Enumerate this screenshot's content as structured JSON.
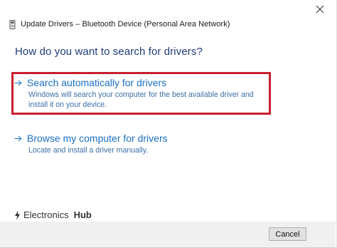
{
  "window": {
    "title": "Update Drivers – Bluetooth Device (Personal Area Network)",
    "close_icon": "close-icon"
  },
  "heading": "How do you want to search for drivers?",
  "options": [
    {
      "label": "Search automatically for drivers",
      "description": "Windows will search your computer for the best available driver and install it on your device.",
      "highlighted": true
    },
    {
      "label": "Browse my computer for drivers",
      "description": "Locate and install a driver manually.",
      "highlighted": false
    }
  ],
  "watermark": {
    "brand_light": "Electronics",
    "brand_bold": "Hub"
  },
  "footer": {
    "cancel_label": "Cancel"
  },
  "colors": {
    "link_blue": "#1a6fc4",
    "heading_blue": "#1f3b78",
    "highlight_red": "#c81e2e",
    "footer_bg": "#f0f0f0"
  }
}
